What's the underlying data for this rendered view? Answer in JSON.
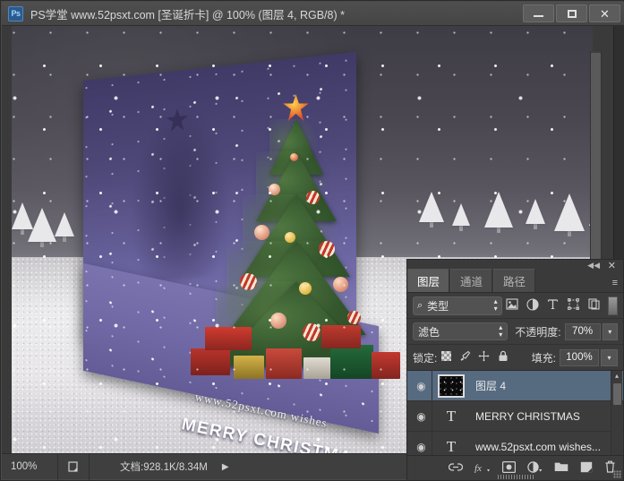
{
  "window": {
    "title": "PS学堂 www.52psxt.com [圣诞折卡] @ 100% (图层 4, RGB/8) *",
    "app_badge": "Ps",
    "minimize_label": "最小化",
    "maximize_label": "最大化",
    "close_label": "✕"
  },
  "document": {
    "card_line1": "www.52psxt.com  wishes",
    "card_line2": "MERRY CHRISTMAS"
  },
  "statusbar": {
    "zoom": "100%",
    "doc_icon": "document-preview-icon",
    "doc_info": "文档:928.1K/8.34M",
    "expand_arrow": "▶"
  },
  "panel": {
    "collapse_icon": "◀◀",
    "close_icon": "✕",
    "menu_icon": "≡",
    "tabs": [
      {
        "label": "图层",
        "active": true
      },
      {
        "label": "通道",
        "active": false
      },
      {
        "label": "路径",
        "active": false
      }
    ],
    "filter": {
      "search_icon": "⌕",
      "kind_label": "类型",
      "stepper": "⬍",
      "tools": [
        "image-filter-icon",
        "adjustment-filter-icon",
        "type-filter-icon",
        "shape-filter-icon",
        "smartobject-filter-icon"
      ],
      "toggle_label": "filter-toggle-switch"
    },
    "blend": {
      "mode": "滤色",
      "opacity_label": "不透明度:",
      "opacity_value": "70%"
    },
    "lock": {
      "label": "锁定:",
      "icons": [
        "lock-transparency-icon",
        "lock-image-icon",
        "lock-position-icon",
        "lock-all-icon"
      ],
      "fill_label": "填充:",
      "fill_value": "100%"
    },
    "layers": [
      {
        "name": "图层 4",
        "kind": "pixel",
        "selected": true,
        "visible": true
      },
      {
        "name": "MERRY CHRISTMAS",
        "kind": "text",
        "selected": false,
        "visible": true
      },
      {
        "name": "www.52psxt.com wishes...",
        "kind": "text",
        "selected": false,
        "visible": true
      }
    ],
    "bottom_buttons": [
      "link-layers-icon",
      "layer-style-icon",
      "layer-mask-icon",
      "adjustment-layer-icon",
      "new-group-icon",
      "new-layer-icon",
      "delete-layer-icon"
    ],
    "eye_glyph": "◉",
    "text_glyph": "T"
  },
  "colors": {
    "panel_bg": "#3c3c3c",
    "selected_layer": "#566a80",
    "title_bar": "#4a4a4a",
    "card_purple": "#6f68a4",
    "accent_blue": "#2b5b8c"
  }
}
